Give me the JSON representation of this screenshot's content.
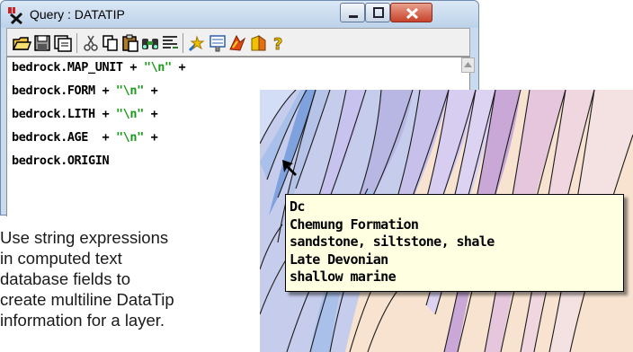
{
  "window": {
    "title": "Query : DATATIP",
    "controls": {
      "minimize_icon": "minimize-icon",
      "maximize_icon": "maximize-icon",
      "close_icon": "close-icon"
    }
  },
  "toolbar": {
    "icons": [
      "open-folder-icon",
      "save-icon",
      "save-as-icon",
      "cut-icon",
      "copy-icon",
      "paste-icon",
      "find-icon",
      "insert-field-icon",
      "function-icon",
      "attributes-icon",
      "run-icon",
      "help-book-icon",
      "help-question-icon"
    ]
  },
  "editor": {
    "lines": [
      {
        "field": "bedrock.MAP_UNIT",
        "op": " + ",
        "str": "\"\\n\"",
        "tail": " +"
      },
      {
        "field": "bedrock.FORM",
        "op": " + ",
        "str": "\"\\n\"",
        "tail": " +"
      },
      {
        "field": "bedrock.LITH",
        "op": " + ",
        "str": "\"\\n\"",
        "tail": " +"
      },
      {
        "field": "bedrock.AGE",
        "op": "  + ",
        "str": "\"\\n\"",
        "tail": " +"
      },
      {
        "field": "bedrock.ORIGIN",
        "op": "",
        "str": "",
        "tail": ""
      }
    ]
  },
  "caption": {
    "lines": [
      "Use string expressions",
      "in computed text",
      "database fields to",
      "create multiline DataTip",
      "information for a layer."
    ]
  },
  "datatip": {
    "lines": [
      "Dc",
      "Chemung Formation",
      "sandstone, siltstone, shale",
      "Late Devonian",
      "shallow marine"
    ]
  },
  "colors": {
    "window_frame": "#c9dbee",
    "string_literal": "#1a9a1a",
    "datatip_bg": "#ffffe1"
  }
}
